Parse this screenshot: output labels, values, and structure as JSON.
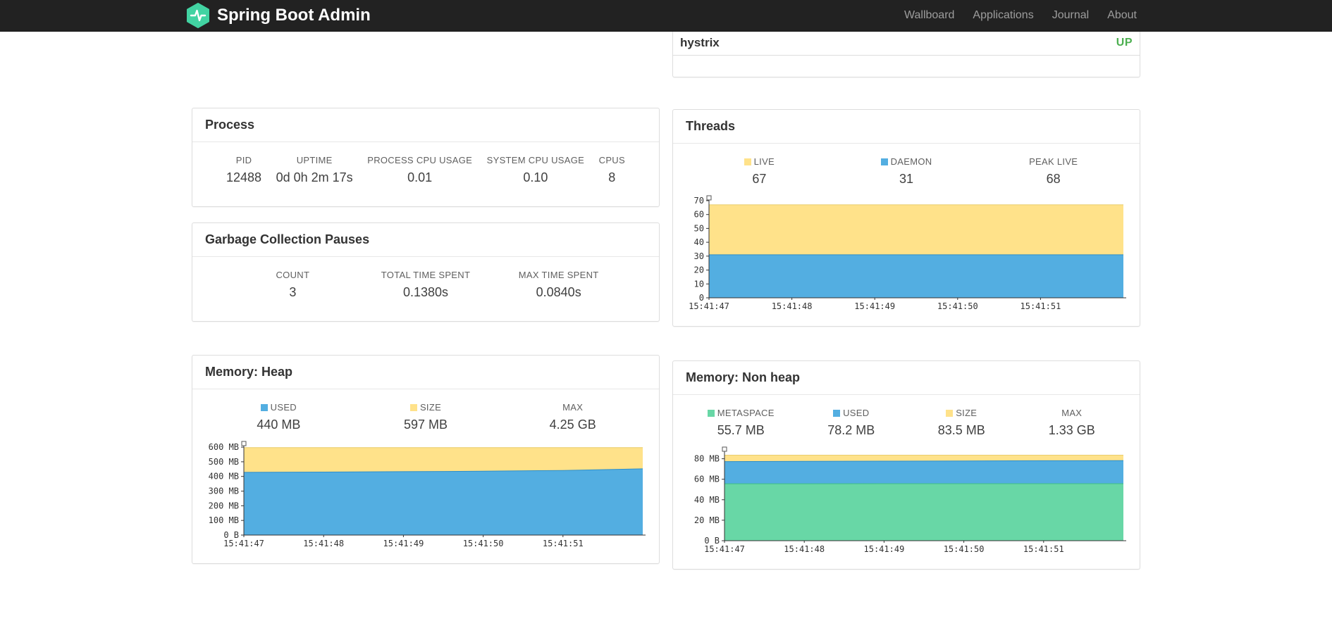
{
  "navbar": {
    "brand": "Spring Boot Admin",
    "links": [
      {
        "label": "Wallboard"
      },
      {
        "label": "Applications"
      },
      {
        "label": "Journal"
      },
      {
        "label": "About"
      }
    ]
  },
  "colors": {
    "brand_green": "#42d3a2",
    "status_up_green": "#4caf50",
    "chart_yellow": "#ffe28a",
    "chart_blue": "#53aee1",
    "chart_green": "#68d7a6"
  },
  "status_panel": {
    "app_name": "hystrix",
    "status": "UP"
  },
  "process_panel": {
    "title": "Process",
    "stats": [
      {
        "label": "PID",
        "value": "12488"
      },
      {
        "label": "UPTIME",
        "value": "0d 0h 2m 17s"
      },
      {
        "label": "PROCESS CPU USAGE",
        "value": "0.01"
      },
      {
        "label": "SYSTEM CPU USAGE",
        "value": "0.10"
      },
      {
        "label": "CPUS",
        "value": "8"
      }
    ]
  },
  "gc_panel": {
    "title": "Garbage Collection Pauses",
    "stats": [
      {
        "label": "COUNT",
        "value": "3"
      },
      {
        "label": "TOTAL TIME SPENT",
        "value": "0.1380s"
      },
      {
        "label": "MAX TIME SPENT",
        "value": "0.0840s"
      }
    ]
  },
  "threads_panel": {
    "title": "Threads",
    "stats": [
      {
        "label": "LIVE",
        "value": "67",
        "swatch": "#ffe28a"
      },
      {
        "label": "DAEMON",
        "value": "31",
        "swatch": "#53aee1"
      },
      {
        "label": "PEAK LIVE",
        "value": "68"
      }
    ]
  },
  "heap_panel": {
    "title": "Memory: Heap",
    "stats": [
      {
        "label": "USED",
        "value": "440 MB",
        "swatch": "#53aee1"
      },
      {
        "label": "SIZE",
        "value": "597 MB",
        "swatch": "#ffe28a"
      },
      {
        "label": "MAX",
        "value": "4.25 GB"
      }
    ]
  },
  "nonheap_panel": {
    "title": "Memory: Non heap",
    "stats": [
      {
        "label": "METASPACE",
        "value": "55.7 MB",
        "swatch": "#68d7a6"
      },
      {
        "label": "USED",
        "value": "78.2 MB",
        "swatch": "#53aee1"
      },
      {
        "label": "SIZE",
        "value": "83.5 MB",
        "swatch": "#ffe28a"
      },
      {
        "label": "MAX",
        "value": "1.33 GB"
      }
    ]
  },
  "chart_data": [
    {
      "id": "threads",
      "type": "area",
      "title": "Threads",
      "x_labels": [
        "15:41:47",
        "15:41:48",
        "15:41:49",
        "15:41:50",
        "15:41:51"
      ],
      "ylim": [
        0,
        71
      ],
      "ytick_values": [
        0,
        10,
        20,
        30,
        40,
        50,
        60,
        70
      ],
      "ytick_labels": [
        "0",
        "10",
        "20",
        "30",
        "40",
        "50",
        "60",
        "70"
      ],
      "legend_position": "top",
      "series": [
        {
          "name": "LIVE",
          "color": "#ffe28a",
          "line": "#e8cd6d",
          "values": [
            67,
            67,
            67,
            67,
            67,
            67
          ]
        },
        {
          "name": "DAEMON",
          "color": "#53aee1",
          "line": "#2f8fc8",
          "values": [
            31,
            31,
            31,
            31,
            31,
            31
          ]
        }
      ]
    },
    {
      "id": "memory-heap",
      "type": "area",
      "title": "Memory: Heap",
      "x_labels": [
        "15:41:47",
        "15:41:48",
        "15:41:49",
        "15:41:50",
        "15:41:51"
      ],
      "ylim": [
        0,
        615
      ],
      "ytick_values": [
        0,
        100,
        200,
        300,
        400,
        500,
        600
      ],
      "ytick_labels": [
        "0 B",
        "100 MB",
        "200 MB",
        "300 MB",
        "400 MB",
        "500 MB",
        "600 MB"
      ],
      "legend_position": "top",
      "series": [
        {
          "name": "SIZE",
          "color": "#ffe28a",
          "line": "#e8cd6d",
          "values": [
            597,
            597,
            597,
            597,
            597,
            597
          ]
        },
        {
          "name": "USED",
          "color": "#53aee1",
          "line": "#2f8fc8",
          "values": [
            428,
            430,
            433,
            436,
            441,
            452
          ]
        }
      ]
    },
    {
      "id": "memory-nonheap",
      "type": "area",
      "title": "Memory: Non heap",
      "x_labels": [
        "15:41:47",
        "15:41:48",
        "15:41:49",
        "15:41:50",
        "15:41:51"
      ],
      "ylim": [
        0,
        88
      ],
      "ytick_values": [
        0,
        20,
        40,
        60,
        80
      ],
      "ytick_labels": [
        "0 B",
        "20 MB",
        "40 MB",
        "60 MB",
        "80 MB"
      ],
      "legend_position": "top",
      "series": [
        {
          "name": "SIZE",
          "color": "#ffe28a",
          "line": "#e8cd6d",
          "values": [
            83.5,
            83.5,
            83.5,
            83.5,
            83.5,
            83.5
          ]
        },
        {
          "name": "USED",
          "color": "#53aee1",
          "line": "#2f8fc8",
          "values": [
            77.3,
            77.5,
            77.7,
            77.9,
            78.1,
            78.2
          ]
        },
        {
          "name": "METASPACE",
          "color": "#68d7a6",
          "line": "#3fbd87",
          "values": [
            55.6,
            55.6,
            55.7,
            55.7,
            55.7,
            55.7
          ]
        }
      ]
    }
  ]
}
